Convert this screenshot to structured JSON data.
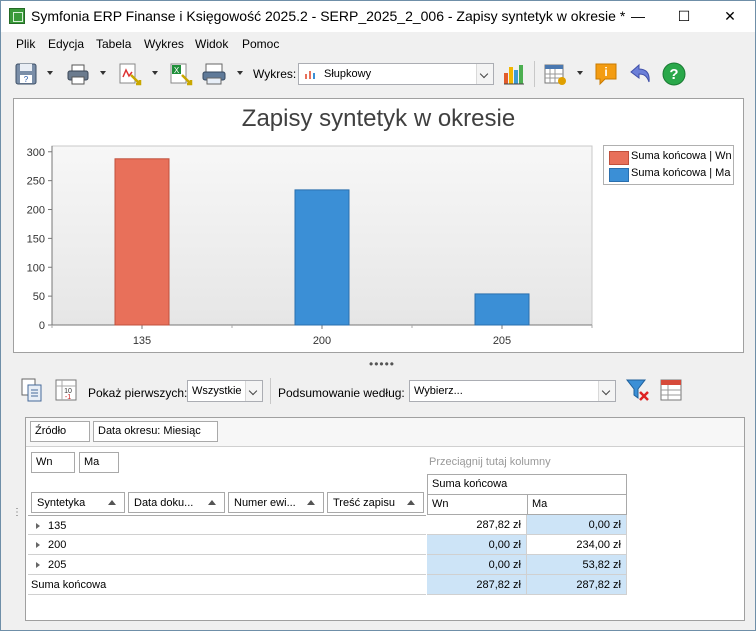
{
  "window": {
    "title": "Symfonia ERP Finanse i Księgowość 2025.2 - SERP_2025_2_006 - Zapisy syntetyk w okresie *",
    "minimize": "—",
    "maximize": "☐",
    "close": "✕"
  },
  "menu": [
    "Plik",
    "Edycja",
    "Tabela",
    "Wykres",
    "Widok",
    "Pomoc"
  ],
  "toolbar": {
    "chart_type_label": "Wykres:",
    "chart_type_value": "Słupkowy"
  },
  "chart_data": {
    "type": "bar",
    "title": "Zapisy syntetyk w okresie",
    "categories": [
      "135",
      "200",
      "205"
    ],
    "series": [
      {
        "name": "Suma końcowa | Wn",
        "values": [
          287.82,
          0,
          0
        ],
        "color": "#e8705a"
      },
      {
        "name": "Suma końcowa | Ma",
        "values": [
          0,
          234.0,
          53.82
        ],
        "color": "#3b8fd6"
      }
    ],
    "yticks": [
      "0",
      "50",
      "100",
      "150",
      "200",
      "250",
      "300"
    ],
    "ylim": [
      0,
      310
    ],
    "legend": "right",
    "grid": false
  },
  "splitter": "•••••",
  "lower_toolbar": {
    "show_first_label": "Pokaż pierwszych:",
    "show_first_value": "Wszystkie",
    "summary_label": "Podsumowanie według:",
    "summary_value": "Wybierz..."
  },
  "grid": {
    "filter_chips": [
      "Źródło",
      "Data okresu: Miesiąc"
    ],
    "data_chips": [
      "Wn",
      "Ma"
    ],
    "drop_hint": "Przeciągnij tutaj kolumny",
    "columns": [
      "Syntetyka",
      "Data doku...",
      "Numer ewi...",
      "Treść zapisu"
    ],
    "data_header": "Suma końcowa",
    "data_subheaders": [
      "Wn",
      "Ma"
    ],
    "rows": [
      {
        "label": "135",
        "wn": "287,82 zł",
        "ma": "0,00 zł"
      },
      {
        "label": "200",
        "wn": "0,00 zł",
        "ma": "234,00 zł"
      },
      {
        "label": "205",
        "wn": "0,00 zł",
        "ma": "53,82 zł"
      }
    ],
    "total": {
      "label": "Suma końcowa",
      "wn": "287,82 zł",
      "ma": "287,82 zł"
    }
  }
}
